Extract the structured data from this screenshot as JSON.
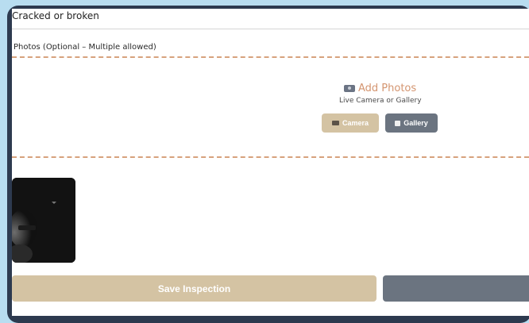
{
  "form": {
    "condition_option": "Cracked or broken",
    "photos_label": "Photos (Optional – Multiple allowed)"
  },
  "upload": {
    "icon": "camera-icon",
    "title": "Add Photos",
    "subtitle": "Live Camera or Gallery",
    "camera_label": "Camera",
    "gallery_label": "Gallery"
  },
  "actions": {
    "save_label": "Save Inspection",
    "secondary_label": ""
  },
  "colors": {
    "accent": "#d49570",
    "primary_button": "#d4c3a3",
    "secondary_button": "#6b7480",
    "frame": "#2d3a4f",
    "background": "#b8ddf0"
  }
}
